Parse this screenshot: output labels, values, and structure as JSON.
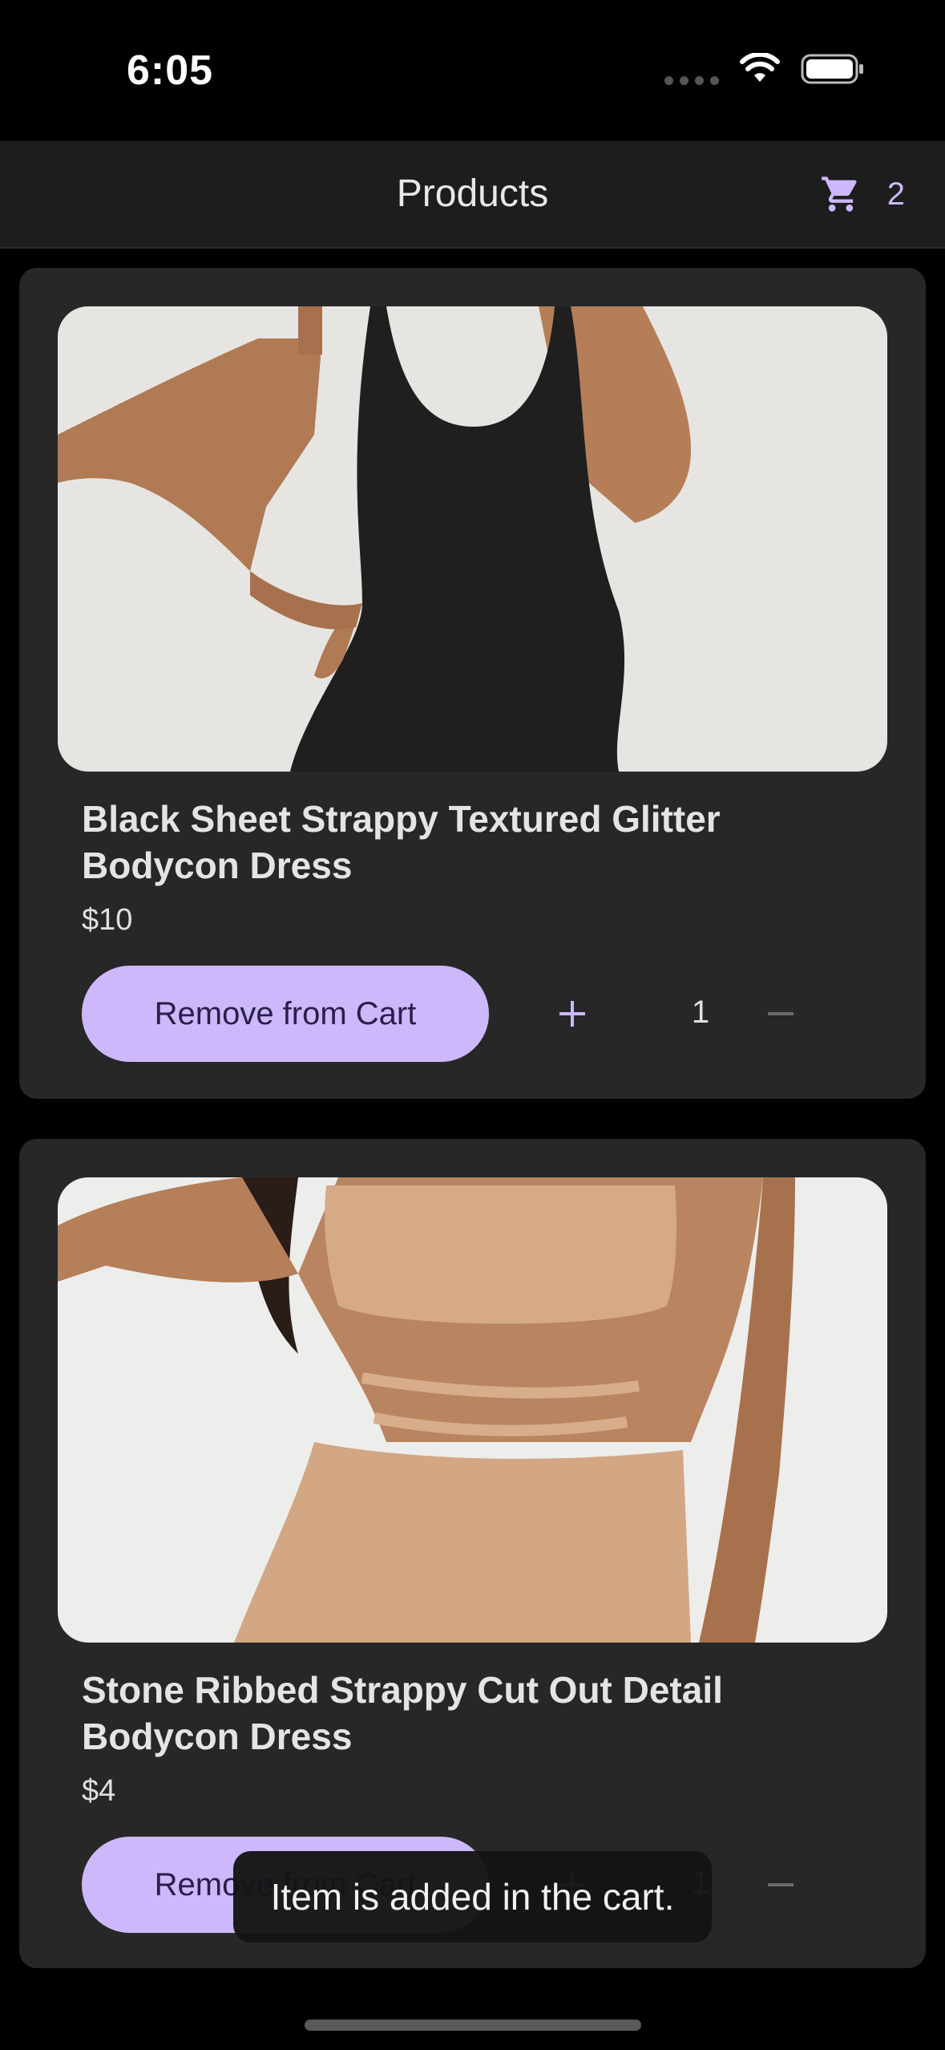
{
  "status_bar": {
    "time": "6:05"
  },
  "app_bar": {
    "title": "Products",
    "cart_count": "2",
    "cart_icon": "shopping-cart-icon"
  },
  "products": [
    {
      "name": "Black Sheet Strappy Textured Glitter Bodycon Dress",
      "price": "$10",
      "button_label": "Remove from Cart",
      "quantity": "1"
    },
    {
      "name": "Stone Ribbed Strappy Cut Out Detail Bodycon Dress",
      "price": "$4",
      "button_label": "Remove from Cart",
      "quantity": "1"
    }
  ],
  "toast": {
    "message": "Item is added in the cart."
  },
  "colors": {
    "accent": "#cdb8fb",
    "background": "#000000",
    "card": "#272727",
    "app_bar": "#1d1d1d"
  }
}
